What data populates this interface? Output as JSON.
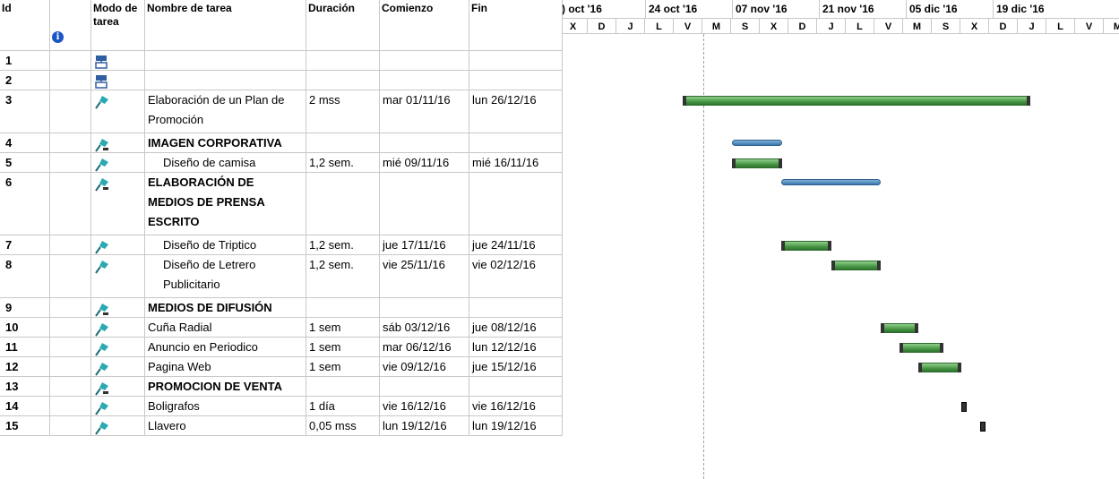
{
  "headers": {
    "id": "Id",
    "mode": "Modo de tarea",
    "name": "Nombre de tarea",
    "duration": "Duración",
    "start": "Comienzo",
    "finish": "Fin",
    "info_icon": "i"
  },
  "timeline": {
    "top": [
      ") oct '16",
      "24 oct '16",
      "07 nov '16",
      "21 nov '16",
      "05 dic '16",
      "19 dic '16"
    ],
    "bottom": [
      "X",
      "D",
      "J",
      "L",
      "V",
      "M",
      "S",
      "X",
      "D",
      "J",
      "L",
      "V",
      "M",
      "S",
      "X",
      "D",
      "J",
      "L",
      "V",
      "M"
    ]
  },
  "tasks": [
    {
      "id": "1",
      "mode": "manual-task-icon",
      "name": "",
      "duration": "",
      "start": "",
      "finish": ""
    },
    {
      "id": "2",
      "mode": "manual-task-icon",
      "name": "",
      "duration": "",
      "start": "",
      "finish": ""
    },
    {
      "id": "3",
      "mode": "auto-task-icon",
      "name": "Elaboración de un Plan de Promoción",
      "duration": "2 mss",
      "start": "mar 01/11/16",
      "finish": "lun 26/12/16"
    },
    {
      "id": "4",
      "mode": "auto-summary-icon",
      "name": "IMAGEN CORPORATIVA",
      "duration": "",
      "start": "",
      "finish": ""
    },
    {
      "id": "5",
      "mode": "auto-task-icon",
      "name": "Diseño de camisa",
      "duration": "1,2 sem.",
      "start": "mié 09/11/16",
      "finish": "mié 16/11/16"
    },
    {
      "id": "6",
      "mode": "auto-summary-icon",
      "name": "ELABORACIÓN DE MEDIOS DE PRENSA ESCRITO",
      "duration": "",
      "start": "",
      "finish": ""
    },
    {
      "id": "7",
      "mode": "auto-task-icon",
      "name": "Diseño de Triptico",
      "duration": "1,2 sem.",
      "start": "jue 17/11/16",
      "finish": "jue 24/11/16"
    },
    {
      "id": "8",
      "mode": "auto-task-icon",
      "name": "Diseño de Letrero Publicitario",
      "duration": "1,2 sem.",
      "start": "vie 25/11/16",
      "finish": "vie 02/12/16"
    },
    {
      "id": "9",
      "mode": "auto-summary-icon",
      "name": "MEDIOS DE DIFUSIÓN",
      "duration": "",
      "start": "",
      "finish": ""
    },
    {
      "id": "10",
      "mode": "auto-task-icon",
      "name": "Cuña Radial",
      "duration": "1 sem",
      "start": "sáb 03/12/16",
      "finish": "jue 08/12/16"
    },
    {
      "id": "11",
      "mode": "auto-task-icon",
      "name": "Anuncio en Periodico",
      "duration": "1 sem",
      "start": "mar 06/12/16",
      "finish": "lun 12/12/16"
    },
    {
      "id": "12",
      "mode": "auto-task-icon",
      "name": "Pagina Web",
      "duration": "1 sem",
      "start": "vie 09/12/16",
      "finish": "jue 15/12/16"
    },
    {
      "id": "13",
      "mode": "auto-summary-icon",
      "name": "PROMOCION DE VENTA",
      "duration": "",
      "start": "",
      "finish": ""
    },
    {
      "id": "14",
      "mode": "auto-task-icon",
      "name": "Boligrafos",
      "duration": "1 día",
      "start": "vie 16/12/16",
      "finish": "vie 16/12/16"
    },
    {
      "id": "15",
      "mode": "auto-task-icon",
      "name": "Llavero",
      "duration": "0,05 mss",
      "start": "lun 19/12/16",
      "finish": "lun 19/12/16"
    }
  ],
  "colors": {
    "task_bar": "#4a9a47",
    "summary_bar": "#3a78ae",
    "grid_line": "#c8c8c8"
  }
}
